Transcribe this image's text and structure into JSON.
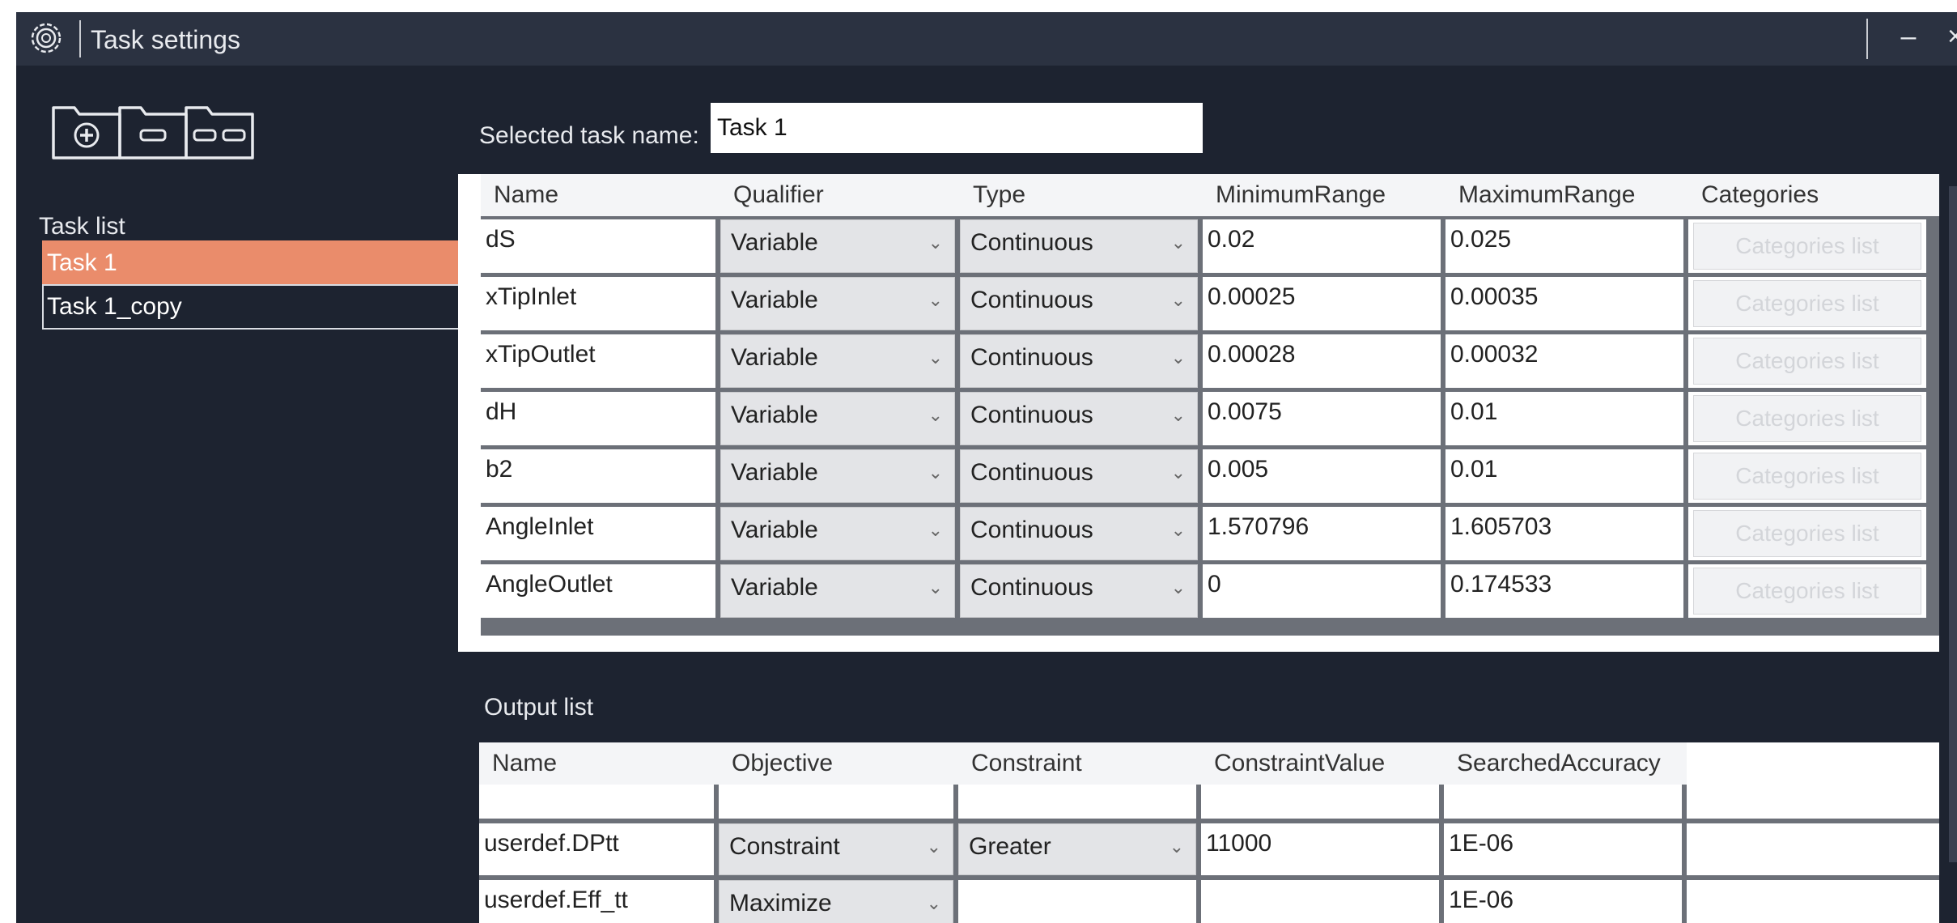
{
  "window": {
    "title": "Task settings"
  },
  "toolbar": {
    "add_icon": "folder-plus-icon",
    "remove_icon": "folder-minus-icon",
    "remove_all_icon": "folder-minus-all-icon"
  },
  "task_list": {
    "label": "Task list",
    "items": [
      "Task 1",
      "Task 1_copy"
    ],
    "selected_index": 0
  },
  "selected_task": {
    "label": "Selected task name:",
    "value": "Task 1"
  },
  "input_table": {
    "headers": [
      "Name",
      "Qualifier",
      "Type",
      "MinimumRange",
      "MaximumRange",
      "Categories"
    ],
    "rows": [
      {
        "name": "dS",
        "qualifier": "Variable",
        "type": "Continuous",
        "min": "0.02",
        "max": "0.025",
        "categories": "Categories list"
      },
      {
        "name": "xTipInlet",
        "qualifier": "Variable",
        "type": "Continuous",
        "min": "0.00025",
        "max": "0.00035",
        "categories": "Categories list"
      },
      {
        "name": "xTipOutlet",
        "qualifier": "Variable",
        "type": "Continuous",
        "min": "0.00028",
        "max": "0.00032",
        "categories": "Categories list"
      },
      {
        "name": "dH",
        "qualifier": "Variable",
        "type": "Continuous",
        "min": "0.0075",
        "max": "0.01",
        "categories": "Categories list"
      },
      {
        "name": "b2",
        "qualifier": "Variable",
        "type": "Continuous",
        "min": "0.005",
        "max": "0.01",
        "categories": "Categories list"
      },
      {
        "name": "AngleInlet",
        "qualifier": "Variable",
        "type": "Continuous",
        "min": "1.570796",
        "max": "1.605703",
        "categories": "Categories list"
      },
      {
        "name": "AngleOutlet",
        "qualifier": "Variable",
        "type": "Continuous",
        "min": "0",
        "max": "0.174533",
        "categories": "Categories list"
      }
    ]
  },
  "output_list": {
    "label": "Output list",
    "headers": [
      "Name",
      "Objective",
      "Constraint",
      "ConstraintValue",
      "SearchedAccuracy"
    ],
    "rows": [
      {
        "name": "userdef.DPtt",
        "objective": "Constraint",
        "constraint": "Greater",
        "constraint_value": "11000",
        "accuracy": "1E-06"
      },
      {
        "name": "userdef.Eff_tt",
        "objective": "Maximize",
        "constraint": "",
        "constraint_value": "",
        "accuracy": "1E-06"
      }
    ]
  },
  "colors": {
    "background": "#1d2330",
    "titlebar": "#2b3241",
    "selected": "#ea8c6b"
  }
}
